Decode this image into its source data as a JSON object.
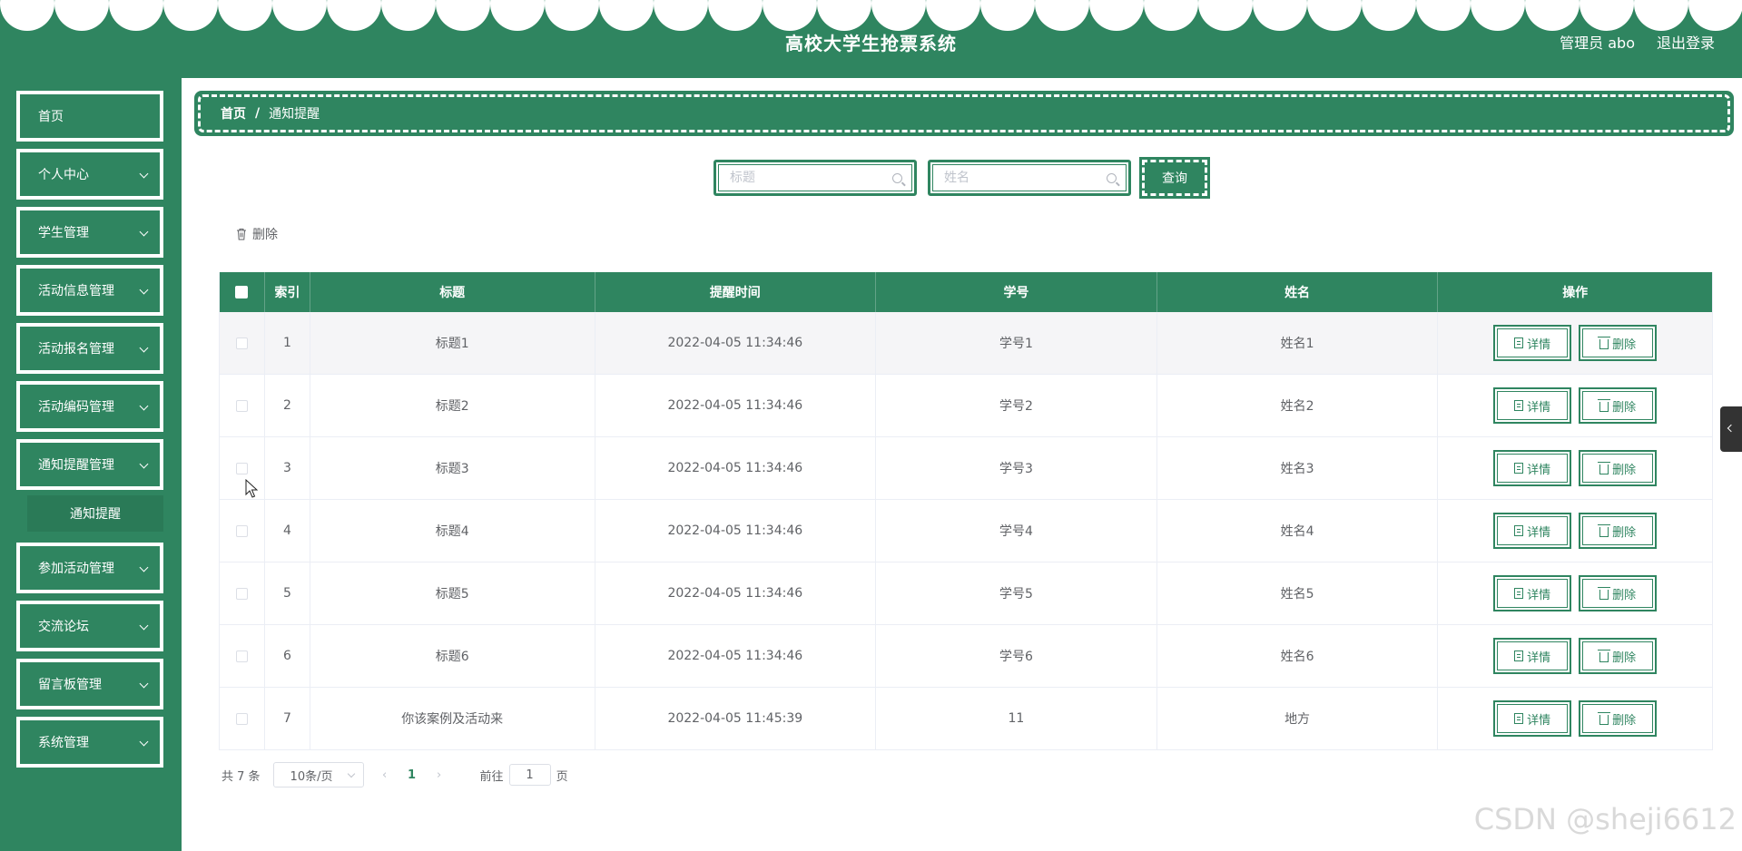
{
  "colors": {
    "primary": "#2f8560",
    "header_bg": "#2f8560",
    "text": "#606266"
  },
  "header": {
    "title": "高校大学生抢票系统",
    "user_label": "管理员 abo",
    "logout_label": "退出登录"
  },
  "sidebar": {
    "items": [
      {
        "label": "首页",
        "has_arrow": false
      },
      {
        "label": "个人中心",
        "has_arrow": true
      },
      {
        "label": "学生管理",
        "has_arrow": true
      },
      {
        "label": "活动信息管理",
        "has_arrow": true
      },
      {
        "label": "活动报名管理",
        "has_arrow": true
      },
      {
        "label": "活动编码管理",
        "has_arrow": true
      },
      {
        "label": "通知提醒管理",
        "has_arrow": true
      },
      {
        "label": "参加活动管理",
        "has_arrow": true
      },
      {
        "label": "交流论坛",
        "has_arrow": true
      },
      {
        "label": "留言板管理",
        "has_arrow": true
      },
      {
        "label": "系统管理",
        "has_arrow": true
      }
    ],
    "submenu": {
      "label": "通知提醒"
    }
  },
  "breadcrumb": {
    "home": "首页",
    "separator": "/",
    "current": "通知提醒"
  },
  "search": {
    "title_placeholder": "标题",
    "name_placeholder": "姓名",
    "query_label": "查询"
  },
  "toolbar": {
    "delete_label": "删除"
  },
  "table": {
    "columns": [
      "索引",
      "标题",
      "提醒时间",
      "学号",
      "姓名",
      "操作"
    ],
    "rows": [
      {
        "index": "1",
        "title": "标题1",
        "time": "2022-04-05 11:34:46",
        "sno": "学号1",
        "name": "姓名1"
      },
      {
        "index": "2",
        "title": "标题2",
        "time": "2022-04-05 11:34:46",
        "sno": "学号2",
        "name": "姓名2"
      },
      {
        "index": "3",
        "title": "标题3",
        "time": "2022-04-05 11:34:46",
        "sno": "学号3",
        "name": "姓名3"
      },
      {
        "index": "4",
        "title": "标题4",
        "time": "2022-04-05 11:34:46",
        "sno": "学号4",
        "name": "姓名4"
      },
      {
        "index": "5",
        "title": "标题5",
        "time": "2022-04-05 11:34:46",
        "sno": "学号5",
        "name": "姓名5"
      },
      {
        "index": "6",
        "title": "标题6",
        "time": "2022-04-05 11:34:46",
        "sno": "学号6",
        "name": "姓名6"
      },
      {
        "index": "7",
        "title": "你该案例及活动来",
        "time": "2022-04-05 11:45:39",
        "sno": "11",
        "name": "地方"
      }
    ],
    "detail_label": "详情",
    "delete_label": "删除"
  },
  "pagination": {
    "total": "共 7 条",
    "page_size": "10条/页",
    "prev": "‹",
    "next": "›",
    "current_page": "1",
    "goto_prefix": "前往",
    "goto_value": "1",
    "goto_suffix": "页"
  },
  "watermark": "CSDN @sheji6612"
}
